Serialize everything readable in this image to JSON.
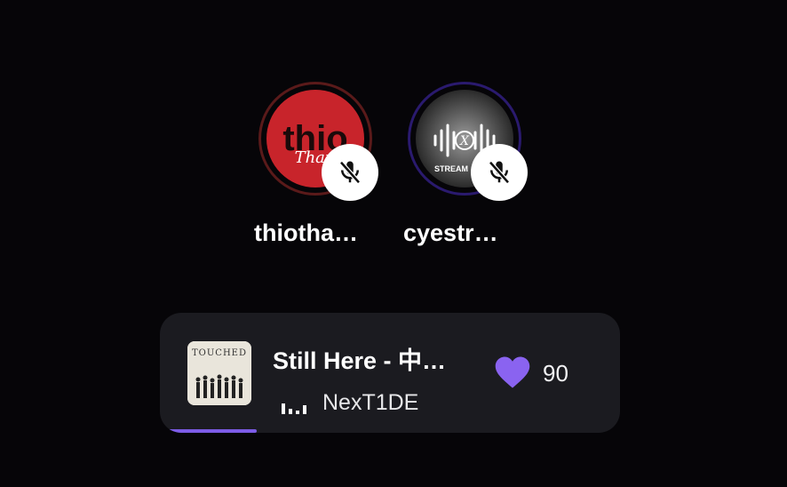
{
  "speakers": [
    {
      "name": "thiotha…",
      "avatar_text": "thio",
      "avatar_script": "Thank",
      "ring_color": "#5a1a1a",
      "muted": true
    },
    {
      "name": "cyestr…",
      "avatar_text": "STREAM",
      "ring_color": "#2a1a6e",
      "muted": true
    }
  ],
  "now_playing": {
    "title": "Still Here - 中…",
    "artist": "NexT1DE",
    "likes": "90",
    "album_art_text": "TOUCHED",
    "accent_color": "#7c5ce6",
    "progress": 0.21
  }
}
